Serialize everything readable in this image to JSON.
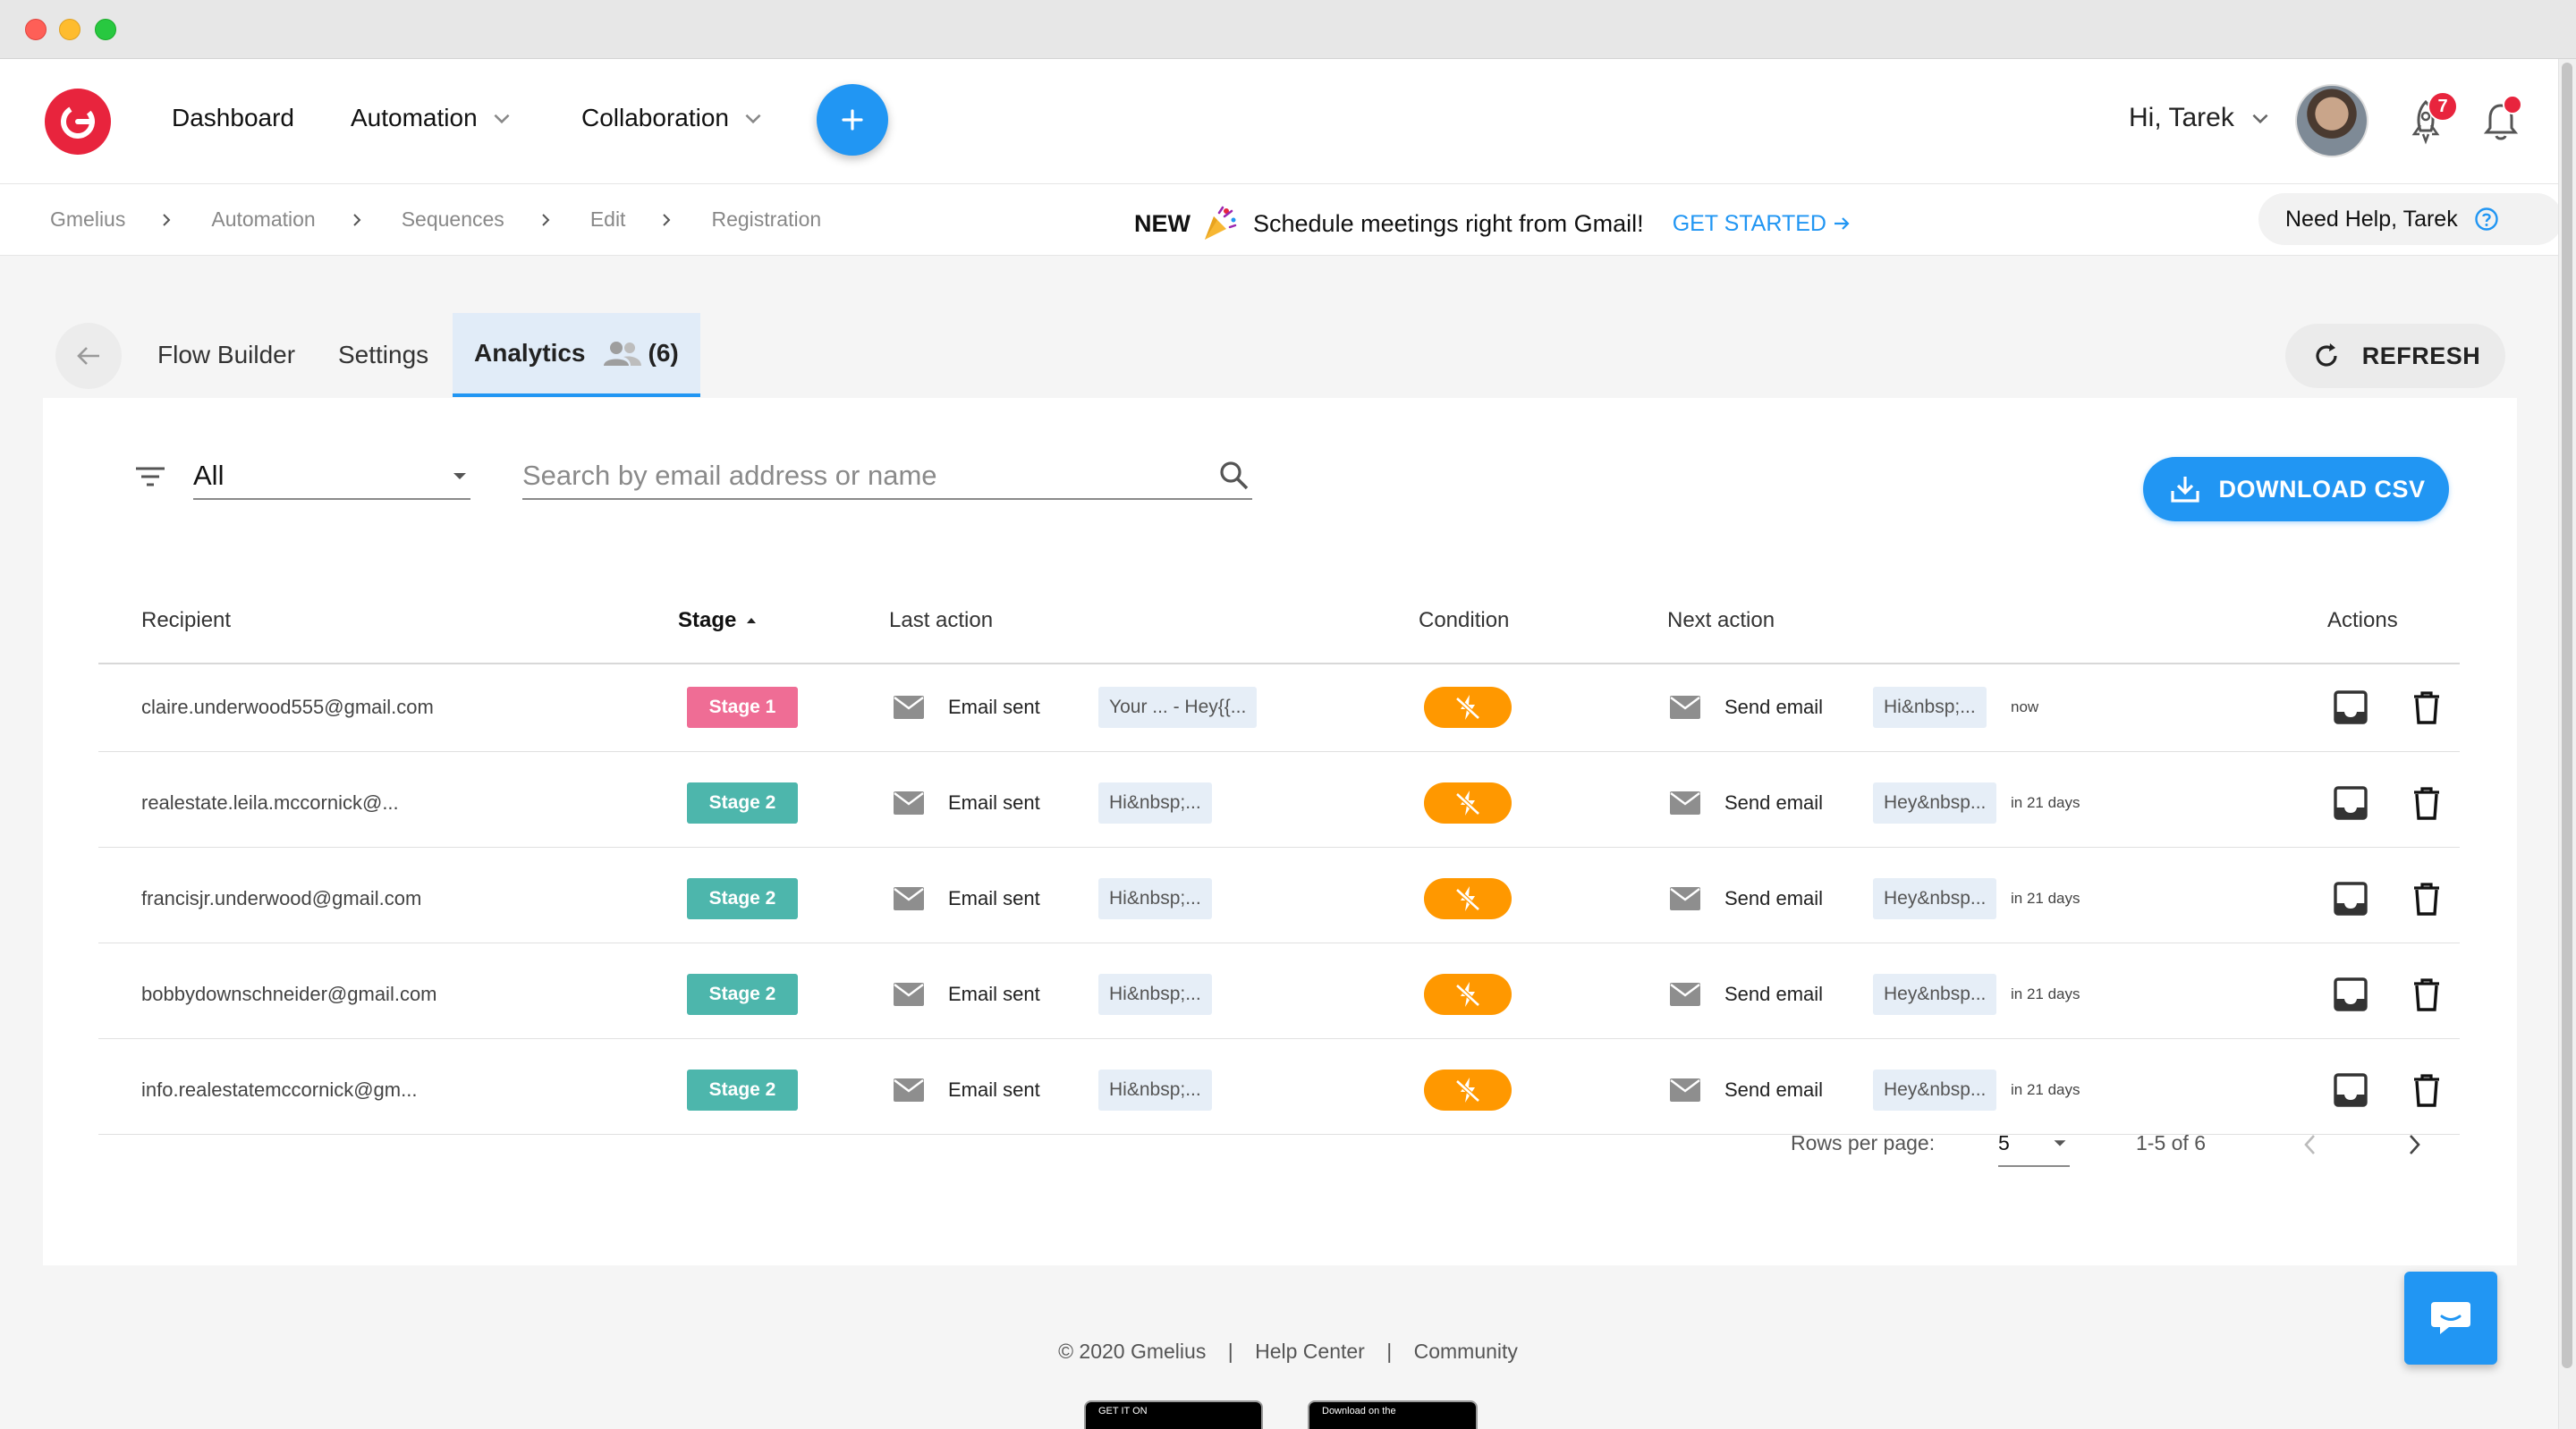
{
  "nav": {
    "items": [
      {
        "label": "Dashboard"
      },
      {
        "label": "Automation"
      },
      {
        "label": "Collaboration"
      }
    ],
    "greeting": "Hi, Tarek",
    "rocket_badge": "7"
  },
  "breadcrumb": [
    "Gmelius",
    "Automation",
    "Sequences",
    "Edit",
    "Registration"
  ],
  "promo": {
    "new": "NEW",
    "text": "Schedule meetings right from Gmail!",
    "cta": "GET STARTED"
  },
  "help": {
    "label": "Need Help, Tarek"
  },
  "tabs": [
    {
      "label": "Flow Builder"
    },
    {
      "label": "Settings"
    },
    {
      "label": "Analytics",
      "count": "(6)"
    }
  ],
  "refresh_label": "REFRESH",
  "filter": {
    "value": "All"
  },
  "search": {
    "placeholder": "Search by email address or name"
  },
  "download_label": "DOWNLOAD CSV",
  "table": {
    "headers": {
      "recipient": "Recipient",
      "stage": "Stage",
      "last_action": "Last action",
      "condition": "Condition",
      "next_action": "Next action",
      "actions": "Actions"
    },
    "rows": [
      {
        "recipient": "claire.underwood555@gmail.com",
        "stage": "Stage 1",
        "last_action": "Email sent",
        "last_preview": "Your ... - Hey{{...",
        "next_action": "Send email",
        "next_preview": "Hi&nbsp;...",
        "when": "now"
      },
      {
        "recipient": "realestate.leila.mccornick@...",
        "stage": "Stage 2",
        "last_action": "Email sent",
        "last_preview": "Hi&nbsp;...",
        "next_action": "Send email",
        "next_preview": "Hey&nbsp...",
        "when": "in 21 days"
      },
      {
        "recipient": "francisjr.underwood@gmail.com",
        "stage": "Stage 2",
        "last_action": "Email sent",
        "last_preview": "Hi&nbsp;...",
        "next_action": "Send email",
        "next_preview": "Hey&nbsp...",
        "when": "in 21 days"
      },
      {
        "recipient": "bobbydownschneider@gmail.com",
        "stage": "Stage 2",
        "last_action": "Email sent",
        "last_preview": "Hi&nbsp;...",
        "next_action": "Send email",
        "next_preview": "Hey&nbsp...",
        "when": "in 21 days"
      },
      {
        "recipient": "info.realestatemccornick@gm...",
        "stage": "Stage 2",
        "last_action": "Email sent",
        "last_preview": "Hi&nbsp;...",
        "next_action": "Send email",
        "next_preview": "Hey&nbsp...",
        "when": "in 21 days"
      }
    ]
  },
  "pagination": {
    "rows_label": "Rows per page:",
    "rows_value": "5",
    "range": "1-5 of 6"
  },
  "footer": {
    "copyright": "© 2020 Gmelius",
    "help": "Help Center",
    "community": "Community",
    "google_play": "GET IT ON",
    "app_store": "Download on the"
  },
  "colors": {
    "accent": "#2196f3",
    "brand": "#e8243d",
    "stage1": "#ef6d95",
    "stage2": "#4db6ac",
    "condition": "#ff9800"
  }
}
